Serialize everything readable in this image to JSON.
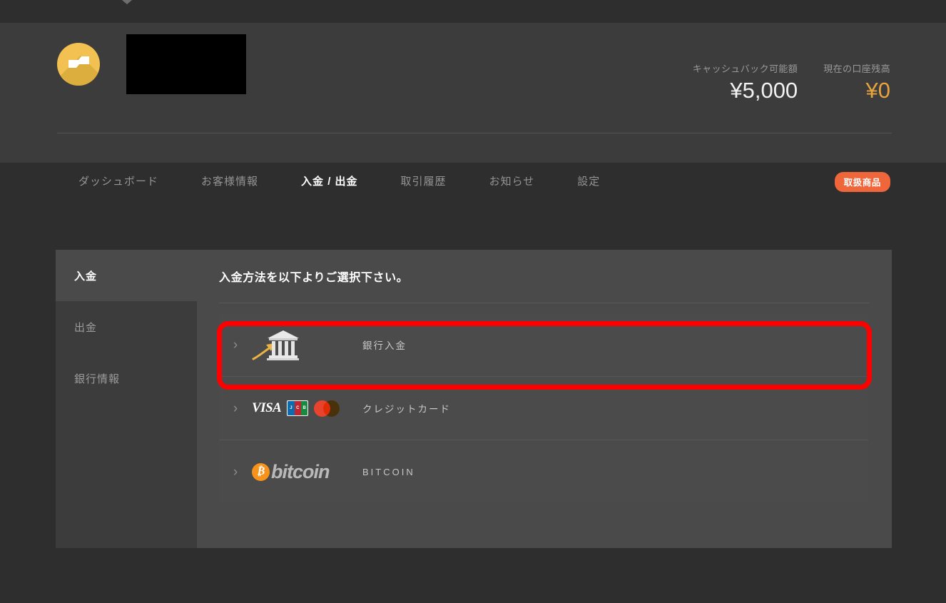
{
  "header": {
    "brand_logo_icon": "swirl-coin-logo",
    "brand_name_redacted": true,
    "balances": [
      {
        "label": "キャッシュバック可能額",
        "value": "¥5,000",
        "accent": false
      },
      {
        "label": "現在の口座残高",
        "value": "¥0",
        "accent": true
      }
    ]
  },
  "tabs": [
    {
      "label": "ダッシュボード",
      "active": false
    },
    {
      "label": "お客様情報",
      "active": false
    },
    {
      "label": "入金 / 出金",
      "active": true
    },
    {
      "label": "取引履歴",
      "active": false
    },
    {
      "label": "お知らせ",
      "active": false
    },
    {
      "label": "設定",
      "active": false
    }
  ],
  "products_button": {
    "label": "取扱商品",
    "color": "#f0663b"
  },
  "sidebar": {
    "items": [
      {
        "label": "入金",
        "active": true
      },
      {
        "label": "出金",
        "active": false
      },
      {
        "label": "銀行情報",
        "active": false
      }
    ]
  },
  "panel": {
    "heading": "入金方法を以下よりご選択下さい。",
    "methods": [
      {
        "label": "銀行入金",
        "logo": "bank-building-icon",
        "chevron": "›",
        "highlighted": true
      },
      {
        "label": "クレジットカード",
        "logo": "visa-jcb-mastercard-logos",
        "chevron": "›",
        "highlighted": false
      },
      {
        "label": "BITCOIN",
        "logo": "bitcoin-logo",
        "chevron": "›",
        "highlighted": false
      }
    ]
  },
  "logos": {
    "visa": "VISA",
    "jcb_letters": [
      "J",
      "C",
      "B"
    ],
    "bitcoin_symbol": "₿",
    "bitcoin_word": "bitcoin"
  },
  "annotation": {
    "type": "red-rounded-rectangle-highlight",
    "color": "#ff0000",
    "target": "銀行入金"
  },
  "colors": {
    "page_bg": "#2e2e2e",
    "header_bg": "#3c3c3c",
    "panel_bg": "#4a4a4a",
    "accent_gold": "#e8a33d",
    "accent_orange": "#f0663b"
  }
}
